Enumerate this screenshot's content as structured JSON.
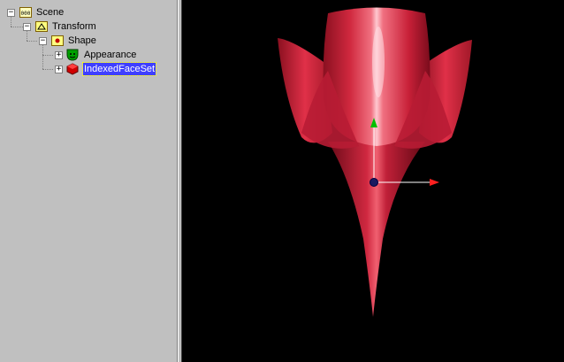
{
  "scene_tree": {
    "nodes": [
      {
        "label": "Scene",
        "expander": "−",
        "icon": "scene-icon",
        "selected": false
      },
      {
        "label": "Transform",
        "expander": "−",
        "icon": "transform-icon",
        "selected": false
      },
      {
        "label": "Shape",
        "expander": "−",
        "icon": "shape-icon",
        "selected": false
      },
      {
        "label": "Appearance",
        "expander": "+",
        "icon": "appearance-icon",
        "selected": false
      },
      {
        "label": "IndexedFaceSet",
        "expander": "+",
        "icon": "indexed-face-set-icon",
        "selected": true
      }
    ]
  },
  "viewport": {
    "background": "#000000",
    "model_color": "#e0304a",
    "axis_colors": {
      "x": "#ff2020",
      "y": "#00c000",
      "origin": "#1a1a60"
    }
  }
}
